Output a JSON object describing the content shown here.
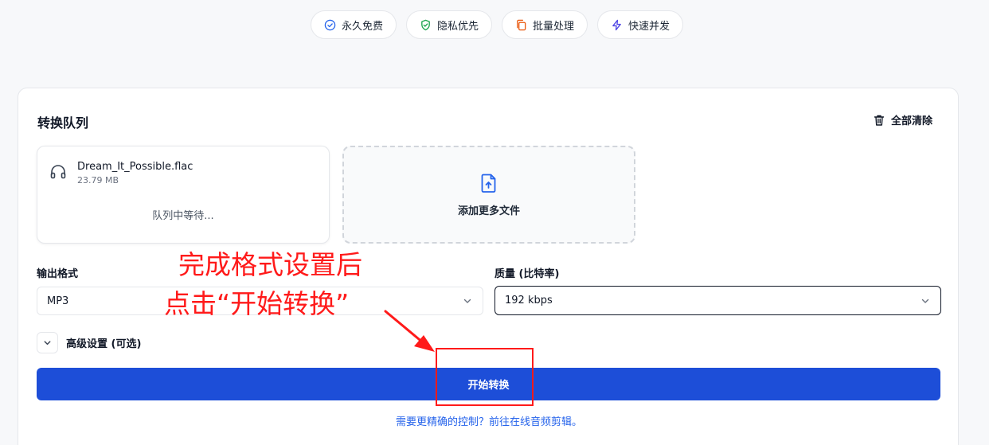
{
  "badges": [
    {
      "label": "永久免费",
      "icon": "check-circle-icon",
      "color": "#2563eb"
    },
    {
      "label": "隐私优先",
      "icon": "shield-check-icon",
      "color": "#16a34a"
    },
    {
      "label": "批量处理",
      "icon": "copy-icon",
      "color": "#ea580c"
    },
    {
      "label": "快速并发",
      "icon": "lightning-icon",
      "color": "#4f46e5"
    }
  ],
  "queue": {
    "title": "转换队列",
    "clear_label": "全部清除",
    "file": {
      "name": "Dream_It_Possible.flac",
      "size": "23.79 MB",
      "status": "队列中等待..."
    },
    "add_label": "添加更多文件"
  },
  "output": {
    "format_label": "输出格式",
    "format_value": "MP3",
    "quality_label": "质量 (比特率)",
    "quality_value": "192 kbps"
  },
  "advanced_label": "高级设置 (可选)",
  "convert_label": "开始转换",
  "more_link": "需要更精确的控制？前往在线音频剪辑。",
  "annotation": {
    "line1": "完成格式设置后",
    "line2": "点击“开始转换”",
    "color": "#ff1a1a"
  },
  "accent_color": "#1d4ed8"
}
